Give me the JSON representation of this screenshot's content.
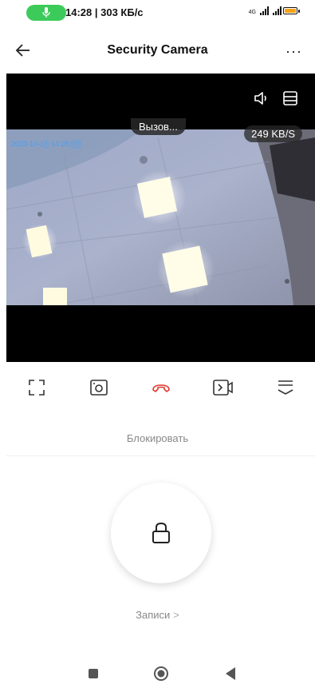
{
  "status_bar": {
    "time_and_rate": "14:28 | 303 КБ/с",
    "network": "4G",
    "icons": [
      "mic-icon",
      "signal-icon",
      "battery-icon"
    ],
    "accent": "#3ccb5a"
  },
  "header": {
    "title": "Security Camera",
    "more": "···",
    "back_icon": "back-arrow-icon"
  },
  "video": {
    "status": "Вызов...",
    "data_rate": "249 KB/S",
    "timestamp": "2023-10-1▒ 14:28:▒▒"
  },
  "controls": {
    "items": [
      "fullscreen-icon",
      "snapshot-icon",
      "hangup-icon",
      "record-video-icon",
      "expand-menu-icon"
    ],
    "hangup_color": "#e03a2e"
  },
  "block_label": "Блокировать",
  "records": {
    "label": "Записи",
    "chevron": ">"
  },
  "navbar": [
    "recents-icon",
    "home-icon",
    "back-icon"
  ]
}
